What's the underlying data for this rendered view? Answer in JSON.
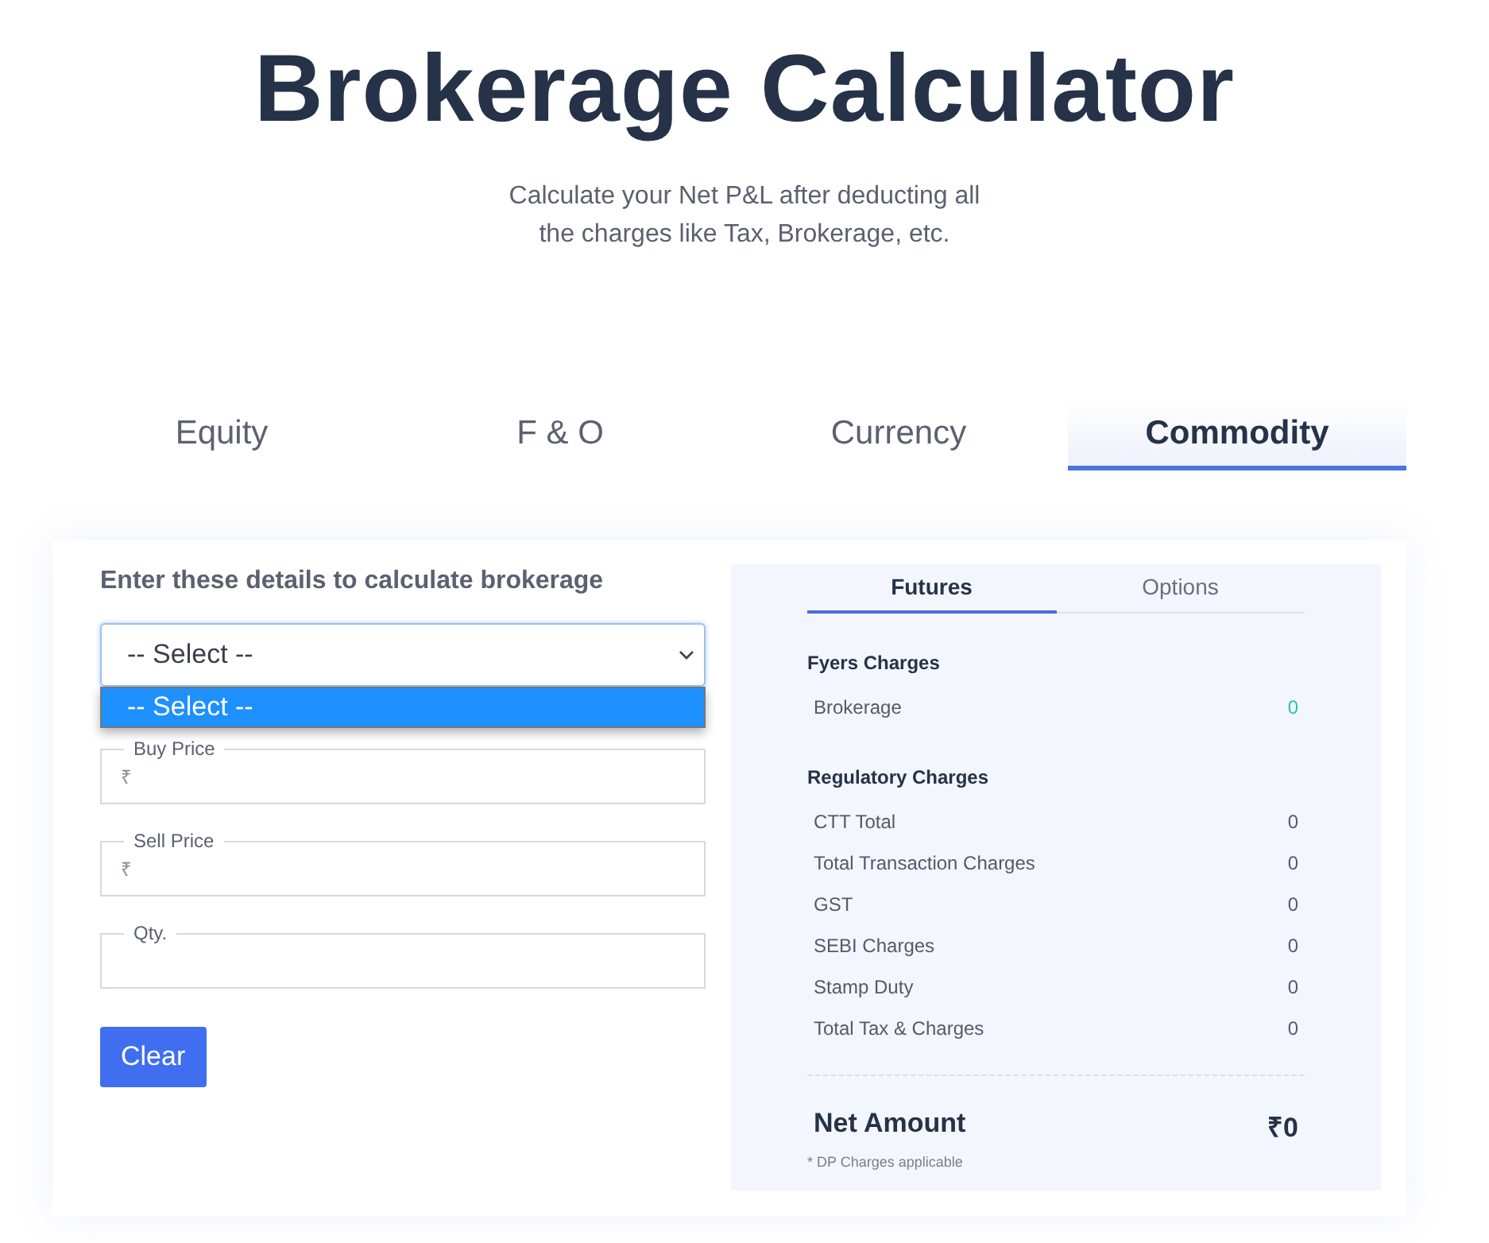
{
  "header": {
    "title": "Brokerage Calculator",
    "subtitle_lines": [
      "Calculate your Net P&L after deducting all",
      "the charges like Tax, Brokerage, etc."
    ]
  },
  "tabs": [
    {
      "label": "Equity",
      "selected": false
    },
    {
      "label": "F & O",
      "selected": false
    },
    {
      "label": "Currency",
      "selected": false
    },
    {
      "label": "Commodity",
      "selected": true
    }
  ],
  "form": {
    "heading": "Enter these details to calculate brokerage",
    "select": {
      "value": "-- Select --",
      "expanded": true,
      "options": [
        {
          "label": "-- Select --",
          "selected": true
        }
      ]
    },
    "fields": [
      {
        "label": "Buy Price",
        "prefix": "₹"
      },
      {
        "label": "Sell Price",
        "prefix": "₹"
      },
      {
        "label": "Qty."
      }
    ],
    "button": "Clear"
  },
  "summary": {
    "tabs": [
      {
        "label": "Futures",
        "selected": true
      },
      {
        "label": "Options",
        "selected": false
      }
    ],
    "groups": [
      {
        "heading": "Fyers Charges",
        "rows": [
          {
            "label": "Brokerage",
            "value": "0",
            "color": "#2ec4a0"
          }
        ]
      },
      {
        "heading": "Regulatory Charges",
        "rows": [
          {
            "label": "CTT Total",
            "value": "0",
            "color": "#555a66"
          },
          {
            "label": "Total Transaction Charges",
            "value": "0",
            "color": "#555a66"
          },
          {
            "label": "GST",
            "value": "0",
            "color": "#555a66"
          },
          {
            "label": "SEBI Charges",
            "value": "0",
            "color": "#555a66"
          },
          {
            "label": "Stamp Duty",
            "value": "0",
            "color": "#555a66"
          },
          {
            "label": "Total Tax & Charges",
            "value": "0",
            "color": "#555a66"
          }
        ]
      }
    ],
    "net": {
      "label": "Net Amount",
      "value": "₹0",
      "note": "* DP Charges applicable"
    }
  }
}
